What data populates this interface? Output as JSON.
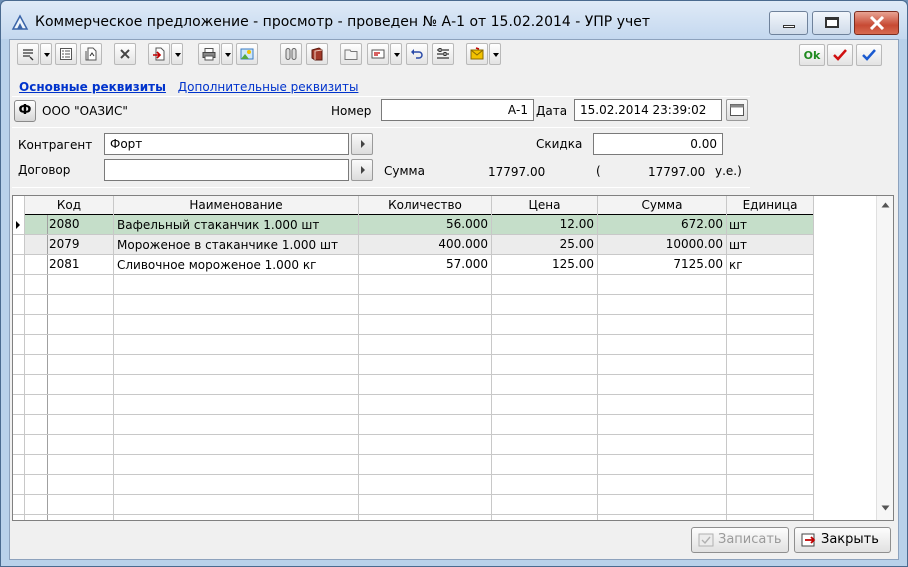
{
  "window": {
    "title": "Коммерческое предложение - просмотр - проведен № А-1 от 15.02.2014 - УПР учет"
  },
  "toolbar": {
    "ok_label": "Ok"
  },
  "tabs": {
    "main": "Основные реквизиты",
    "extra": "Дополнительные реквизиты"
  },
  "header": {
    "firm_button": "Ф",
    "firm_name": "ООО \"ОАЗИС\"",
    "number_label": "Номер",
    "number_value": "А-1",
    "date_label": "Дата",
    "date_value": "15.02.2014 23:39:02"
  },
  "details": {
    "contractor_label": "Контрагент",
    "contractor_value": "Форт",
    "contract_label": "Договор",
    "contract_value": "",
    "discount_label": "Скидка",
    "discount_value": "0.00",
    "sum_label": "Сумма",
    "sum_value": "17797.00",
    "sum_open": "(",
    "sum_ue_value": "17797.00",
    "sum_ue_label": "у.е.)"
  },
  "table": {
    "columns": [
      "Код",
      "Наименование",
      "Количество",
      "Цена",
      "Сумма",
      "Единица"
    ],
    "rows": [
      {
        "code": "2080",
        "name": "Вафельный стаканчик 1.000 шт",
        "qty": "56.000",
        "price": "12.00",
        "sum": "672.00",
        "unit": "шт"
      },
      {
        "code": "2079",
        "name": "Мороженое в стаканчике 1.000 шт",
        "qty": "400.000",
        "price": "25.00",
        "sum": "10000.00",
        "unit": "шт"
      },
      {
        "code": "2081",
        "name": "Сливочное мороженое 1.000 кг",
        "qty": "57.000",
        "price": "125.00",
        "sum": "7125.00",
        "unit": "кг"
      }
    ]
  },
  "buttons": {
    "save": "Записать",
    "close": "Закрыть"
  },
  "colors": {
    "selected_row": "#c5dec9",
    "second_row": "#f0f0f0",
    "link": "#0033cc"
  }
}
